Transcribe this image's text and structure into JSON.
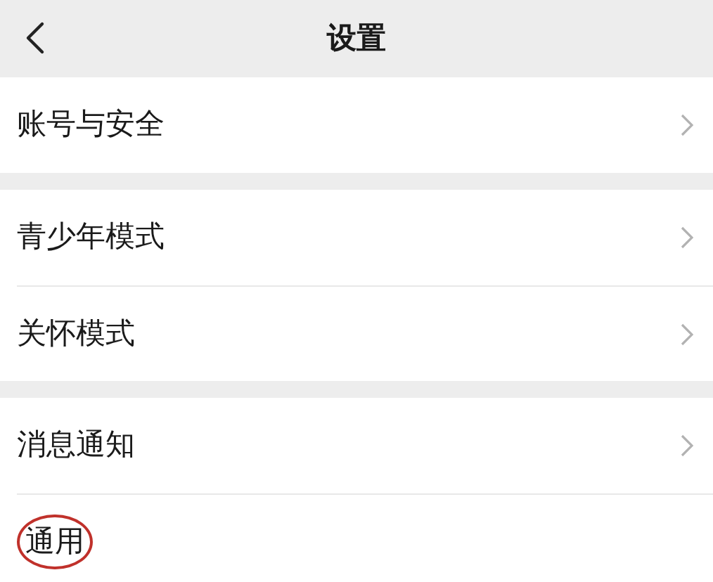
{
  "header": {
    "title": "设置"
  },
  "groups": [
    {
      "items": [
        {
          "label": "账号与安全",
          "chevron": true,
          "highlighted": false
        }
      ]
    },
    {
      "items": [
        {
          "label": "青少年模式",
          "chevron": true,
          "highlighted": false
        },
        {
          "label": "关怀模式",
          "chevron": true,
          "highlighted": false
        }
      ]
    },
    {
      "items": [
        {
          "label": "消息通知",
          "chevron": true,
          "highlighted": false
        },
        {
          "label": "通用",
          "chevron": false,
          "highlighted": true
        }
      ]
    }
  ]
}
